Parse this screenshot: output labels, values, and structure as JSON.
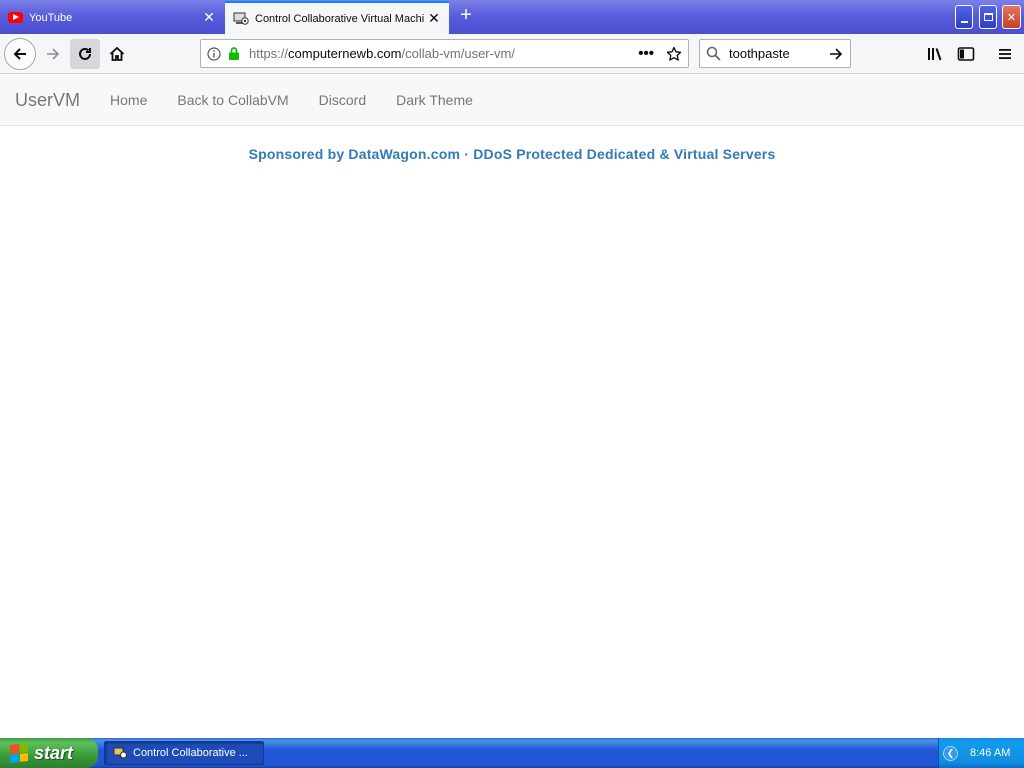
{
  "window": {
    "tabs": [
      {
        "label": "YouTube",
        "icon": "youtube-favicon",
        "active": false
      },
      {
        "label": "Control Collaborative Virtual Machi",
        "icon": "collabvm-favicon",
        "active": true
      }
    ],
    "new_tab_icon": "plus-icon",
    "controls": {
      "minimize": "minimize-icon",
      "maximize": "restore-icon",
      "close": "close-icon"
    }
  },
  "toolbar": {
    "url_prefix": "https://",
    "url_domain": "computernewb.com",
    "url_path": "/collab-vm/user-vm/",
    "search_value": "toothpaste",
    "accent": "#0a84ff",
    "secure_color": "#12bc00"
  },
  "site": {
    "brand": "UserVM",
    "nav": [
      "Home",
      "Back to CollabVM",
      "Discord",
      "Dark Theme"
    ],
    "sponsor": "Sponsored by DataWagon.com · DDoS Protected Dedicated & Virtual Servers",
    "link_color": "#337ab7"
  },
  "taskbar": {
    "start_label": "start",
    "task_label": "Control Collaborative ...",
    "clock": "8:46 AM"
  }
}
